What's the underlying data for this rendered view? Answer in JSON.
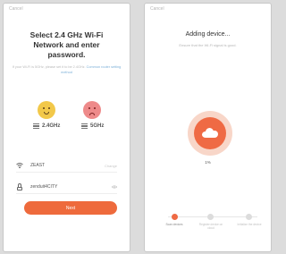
{
  "left_screen": {
    "cancel_label": "Cancel",
    "title": "Select 2.4 GHz Wi-Fi Network and enter password.",
    "hint_text": "If your Wi-Fi is 5GHz, please set it to be 2.4GHz.",
    "hint_link": "Common router setting method",
    "band_ok_label": "2.4GHz",
    "band_bad_label": "5GHz",
    "ssid_value": "ZEAST",
    "ssid_action": "Change",
    "password_value": "zenduit4CITY",
    "next_button_label": "Next",
    "colors": {
      "accent": "#ee6a3c",
      "ok": "#f2c84a",
      "bad": "#ee8a8a"
    }
  },
  "right_screen": {
    "cancel_label": "Cancel",
    "title": "Adding device...",
    "subtitle": "Ensure that the Wi-Fi signal is good.",
    "progress_percent": "1%",
    "steps": [
      {
        "label": "Scan devices",
        "active": true
      },
      {
        "label": "Register device on cloud",
        "active": false
      },
      {
        "label": "Initialize the device",
        "active": false
      }
    ],
    "colors": {
      "accent": "#ef6a44"
    }
  }
}
